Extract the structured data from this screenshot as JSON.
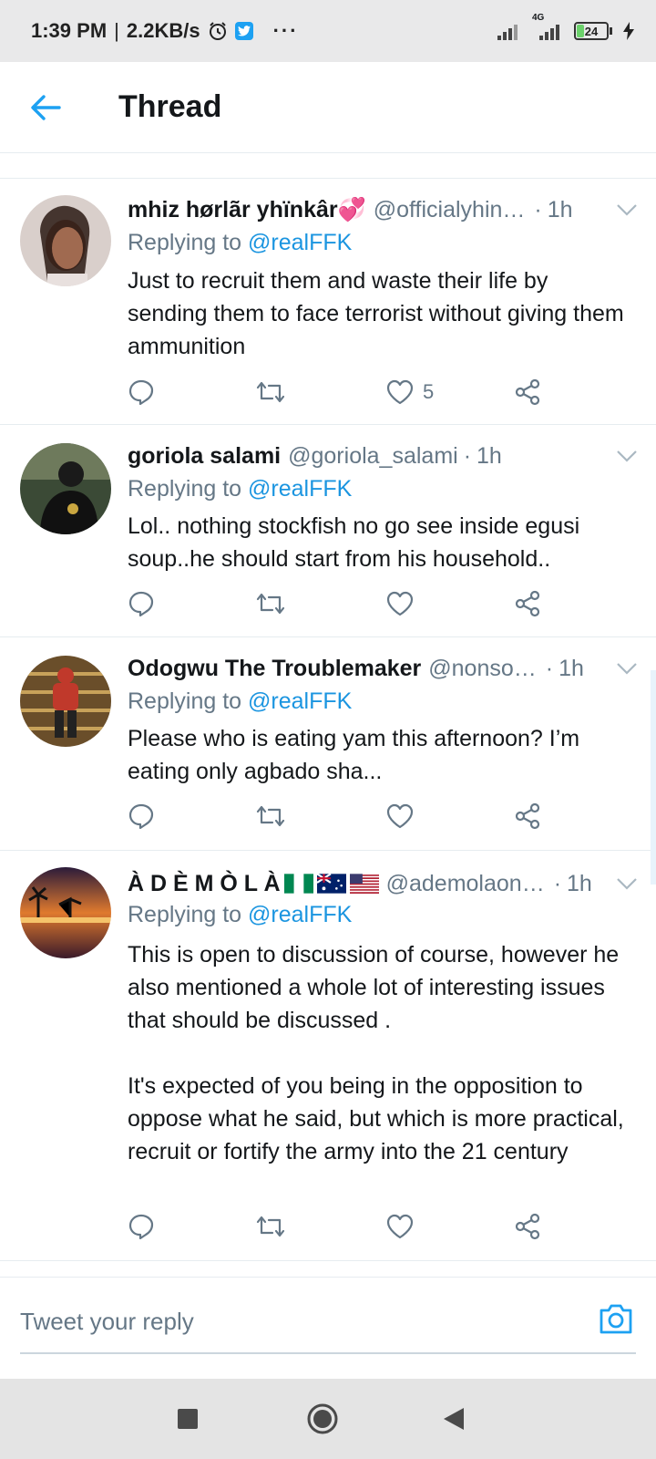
{
  "status_bar": {
    "time": "1:39 PM",
    "separator": "|",
    "speed": "2.2KB/s",
    "dots": "···",
    "network": "4G",
    "battery": "24",
    "battery_fraction": 0.24
  },
  "header": {
    "title": "Thread"
  },
  "tweets": [
    {
      "name": "mhiz hørlãr yhïnkâr💞",
      "handle": "@officialyhin…",
      "time": "1h",
      "replying_prefix": "Replying to",
      "replying_to": "@realFFK",
      "text": "Just to recruit them and waste their life by sending them to face terrorist without giving them ammunition",
      "likes": "5"
    },
    {
      "name": "goriola salami",
      "handle": "@goriola_salami",
      "time": "1h",
      "replying_prefix": "Replying to",
      "replying_to": "@realFFK",
      "text": "Lol.. nothing stockfish no go see inside egusi soup..he should start from his household..",
      "likes": ""
    },
    {
      "name": "Odogwu The Troublemaker",
      "handle": "@nonso…",
      "time": "1h",
      "replying_prefix": "Replying to",
      "replying_to": "@realFFK",
      "text": "Please who is eating yam this afternoon? I’m eating only agbado sha...",
      "likes": ""
    },
    {
      "name": "À D È M Ò L À",
      "handle": "@ademolaon…",
      "time": "1h",
      "replying_prefix": "Replying to",
      "replying_to": "@realFFK",
      "text": "This is open to discussion of course, however he also mentioned a whole lot of interesting issues that should be discussed .\n\nIt's expected of you being in the opposition to oppose what he said, but which is more practical, recruit or fortify the army into the 21 century",
      "likes": ""
    }
  ],
  "reply_bar": {
    "placeholder": "Tweet your reply"
  },
  "colors": {
    "accent": "#1da1f2",
    "mention": "#1b95e0",
    "secondary_text": "#657786",
    "divider": "#e6ecf0"
  },
  "icons": {
    "back": "arrow-left-icon",
    "reply": "reply-icon",
    "retweet": "retweet-icon",
    "like": "heart-icon",
    "share": "share-icon",
    "caret": "chevron-down-icon",
    "camera": "camera-icon"
  }
}
